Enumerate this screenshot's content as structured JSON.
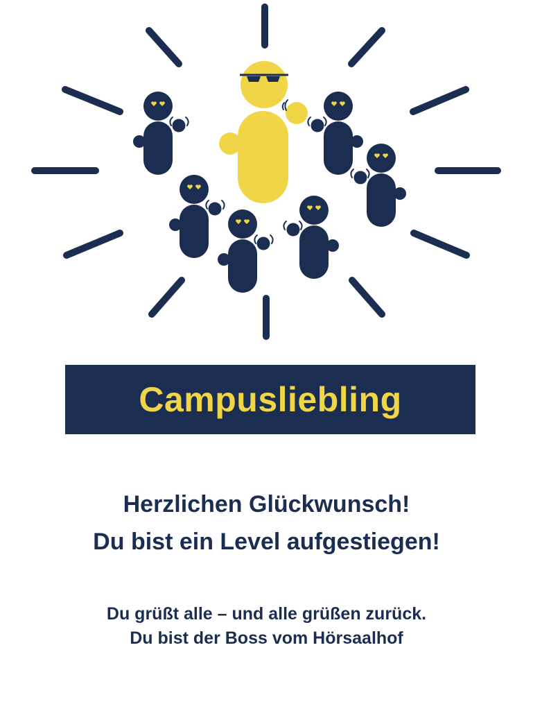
{
  "badge": {
    "title": "Campusliebling"
  },
  "message": {
    "headline_1": "Herzlichen Glückwunsch!",
    "headline_2": "Du bist ein Level aufgestiegen!",
    "subline_1": "Du grüßt alle – und alle grüßen zurück.",
    "subline_2": "Du bist der Boss vom Hörsaalhof"
  },
  "illustration": {
    "icons": [
      "sun-ray-icon",
      "cool-figure-icon",
      "heart-eyes-figure-icon",
      "sunglasses-icon",
      "waving-hand-icon"
    ]
  },
  "colors": {
    "navy": "#1b2d50",
    "yellow": "#f0d646",
    "background": "#ffffff"
  }
}
